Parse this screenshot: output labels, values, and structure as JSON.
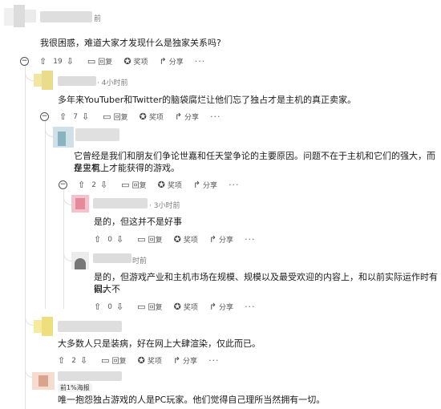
{
  "actions": {
    "upvote_icon": "arrow-up-icon",
    "downvote_icon": "arrow-down-icon",
    "reply_label": "回复",
    "award_label": "奖项",
    "share_label": "分享",
    "more_label": "···"
  },
  "comments": [
    {
      "meta": "前",
      "text": "我很困惑，难道大家才发现什么是独家关系吗?",
      "score": "19"
    },
    {
      "meta": "· 4小时前",
      "text": "多年来YouTuber和Twitter的脑袋腐烂让他们忘了独占才是主机的真正卖家。",
      "score": "7"
    },
    {
      "meta": "",
      "text_lines": [
        "它曾经是我们和朋友们争论世嘉和任天堂争论的主要原因。问题不在于主机和它们的强大，而是只有",
        "在主机上才能获得的游戏。"
      ],
      "score": "2"
    },
    {
      "meta": "· 3小时前",
      "text": "是的，但这并不是好事",
      "score": "0"
    },
    {
      "meta": "时前",
      "text_lines": [
        "是的，但游戏产业和主机市场在规模、规模以及最受欢迎的内容上，和以前实际运作时有很大不",
        "同。"
      ],
      "score": "0"
    },
    {
      "meta": "",
      "text": "大多数人只是装病，好在网上大肆渲染，仅此而已。",
      "score": "2"
    },
    {
      "meta": "",
      "flair": "前1%海报",
      "text": "唯一抱怨独占游戏的人是PC玩家。他们觉得自己理所当然拥有一切。"
    }
  ]
}
